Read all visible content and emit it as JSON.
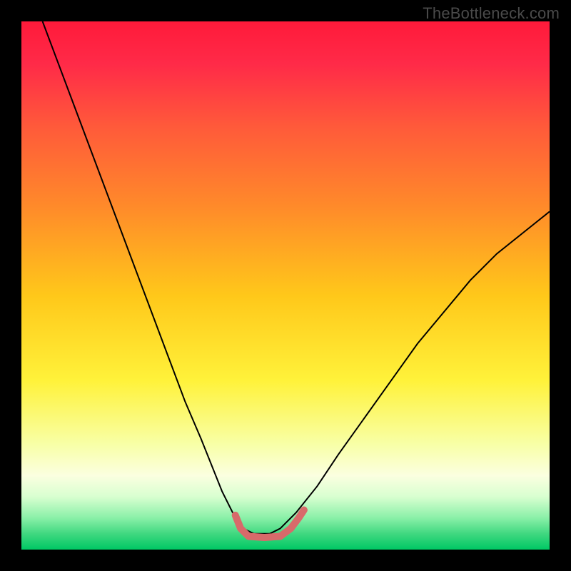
{
  "watermark": "TheBottleneck.com",
  "chart_data": {
    "type": "line",
    "title": "",
    "xlabel": "",
    "ylabel": "",
    "xlim": [
      0,
      100
    ],
    "ylim": [
      0,
      100
    ],
    "gradient_stops": [
      {
        "pos": 0.0,
        "color": "#ff1a3a"
      },
      {
        "pos": 0.08,
        "color": "#ff2a48"
      },
      {
        "pos": 0.2,
        "color": "#ff5a3a"
      },
      {
        "pos": 0.35,
        "color": "#ff8a2a"
      },
      {
        "pos": 0.52,
        "color": "#ffc81a"
      },
      {
        "pos": 0.68,
        "color": "#fff23a"
      },
      {
        "pos": 0.8,
        "color": "#f8ffa6"
      },
      {
        "pos": 0.86,
        "color": "#fbffe0"
      },
      {
        "pos": 0.9,
        "color": "#d8ffd0"
      },
      {
        "pos": 0.94,
        "color": "#8af0a8"
      },
      {
        "pos": 0.97,
        "color": "#40d880"
      },
      {
        "pos": 1.0,
        "color": "#00c864"
      }
    ],
    "series": [
      {
        "name": "bottleneck-curve",
        "stroke": "#000000",
        "width": 2,
        "x": [
          4,
          7,
          10,
          13,
          16,
          19,
          22,
          25,
          28,
          31,
          34,
          36,
          38,
          40,
          42,
          44,
          47,
          49,
          52,
          56,
          60,
          65,
          70,
          75,
          80,
          85,
          90,
          95,
          100
        ],
        "y": [
          100,
          92,
          84,
          76,
          68,
          60,
          52,
          44,
          36,
          28,
          21,
          16,
          11,
          7,
          4,
          3,
          3,
          4,
          7,
          12,
          18,
          25,
          32,
          39,
          45,
          51,
          56,
          60,
          64
        ]
      },
      {
        "name": "optimal-highlight",
        "stroke": "#d86a6a",
        "width": 10,
        "linecap": "round",
        "x": [
          40.5,
          41.5,
          43,
          46,
          49,
          51,
          52.5,
          53.5
        ],
        "y": [
          6.5,
          4,
          2.5,
          2.3,
          2.5,
          4,
          6,
          7.5
        ]
      }
    ]
  }
}
